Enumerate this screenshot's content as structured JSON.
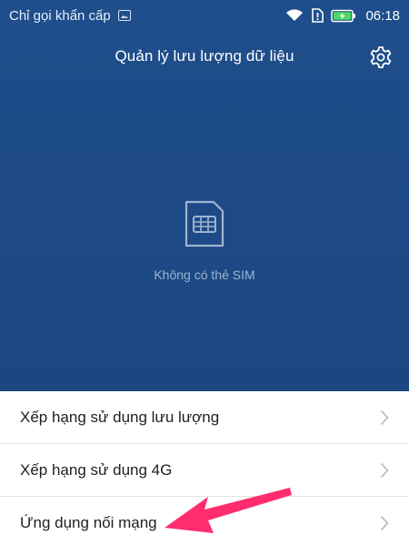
{
  "status_bar": {
    "carrier_text": "Chỉ gọi khẩn cấp",
    "time": "06:18",
    "icons": [
      "image-notification-icon",
      "wifi-icon",
      "sim-alert-icon",
      "battery-charging-icon"
    ],
    "battery_color": "#4cd964"
  },
  "header": {
    "title": "Quản lý lưu lượng dữ liệu",
    "settings_icon": "gear-icon"
  },
  "sim_status": {
    "icon": "sim-card-icon",
    "label": "Không có thẻ SIM"
  },
  "menu": {
    "items": [
      {
        "label": "Xếp hạng sử dụng lưu lượng"
      },
      {
        "label": "Xếp hạng sử dụng 4G"
      },
      {
        "label": "Ứng dụng nối mạng"
      }
    ]
  },
  "colors": {
    "header_bg": "#1f4e8c",
    "annotation_arrow": "#ff2d6f"
  }
}
